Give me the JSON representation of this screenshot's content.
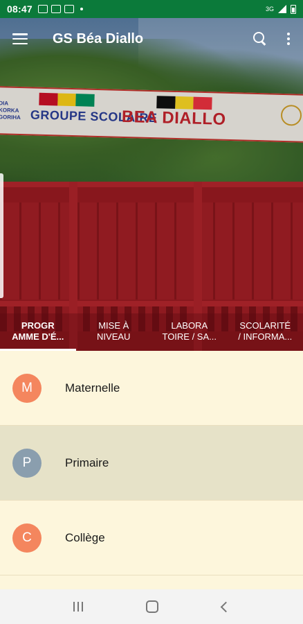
{
  "status_bar": {
    "time": "08:47",
    "network": "3G",
    "notification_icons": [
      "gallery-icon",
      "image-icon",
      "app-icon"
    ]
  },
  "app_bar": {
    "title": "GS Béa Diallo",
    "menu_icon": "hamburger-menu-icon",
    "search_icon": "search-icon",
    "more_icon": "more-vert-icon"
  },
  "hero_banner": {
    "text_left": "GROUPE SCOLAIRE",
    "text_right": "BEA DIALLO",
    "side_text": [
      "DIA",
      "KORKA",
      "GORIHA"
    ]
  },
  "tabs": [
    {
      "label": "PROGR\nAMME D'É...",
      "active": true
    },
    {
      "label": "MISE À\nNIVEAU",
      "active": false
    },
    {
      "label": "LABORA\nTOIRE / SA...",
      "active": false
    },
    {
      "label": "SCOLARITÉ\n/ INFORMA...",
      "active": false
    }
  ],
  "list": [
    {
      "letter": "M",
      "label": "Maternelle",
      "color": "#f4865e",
      "selected": false
    },
    {
      "letter": "P",
      "label": "Primaire",
      "color": "#8a9eae",
      "selected": true
    },
    {
      "letter": "C",
      "label": "Collège",
      "color": "#f4865e",
      "selected": false
    }
  ],
  "colors": {
    "status_bar": "#0b7a3a",
    "list_background": "#fdf6dc",
    "selected_row": "#e6e2c8"
  },
  "nav_bar": {
    "recent_icon": "recent-apps-icon",
    "home_icon": "home-icon",
    "back_icon": "back-icon"
  }
}
